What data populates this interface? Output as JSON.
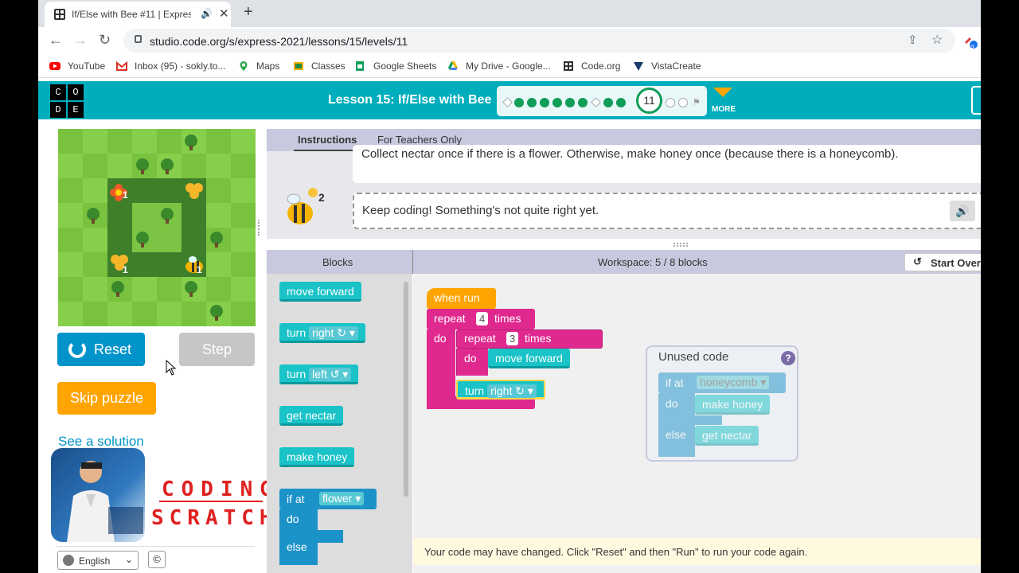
{
  "browser": {
    "tab_title": "If/Else with Bee #11 | Express",
    "url": "studio.code.org/s/express-2021/lessons/15/levels/11",
    "bookmarks": [
      {
        "label": "YouTube",
        "icon": "youtube-icon"
      },
      {
        "label": "Inbox (95) - sokly.to...",
        "icon": "gmail-icon"
      },
      {
        "label": "Maps",
        "icon": "maps-icon"
      },
      {
        "label": "Classes",
        "icon": "classes-icon"
      },
      {
        "label": "Google Sheets",
        "icon": "sheets-icon"
      },
      {
        "label": "My Drive - Google...",
        "icon": "drive-icon"
      },
      {
        "label": "Code.org",
        "icon": "codeorg-icon"
      },
      {
        "label": "VistaCreate",
        "icon": "vistacreate-icon"
      }
    ],
    "extension_badge": "2"
  },
  "header": {
    "logo_letters": [
      "C",
      "O",
      "D",
      "E"
    ],
    "lesson_title": "Lesson 15: If/Else with Bee",
    "current_level": "11",
    "more_label": "MORE",
    "accent": "#00adbc"
  },
  "game": {
    "flower_count_1": "1",
    "flower_count_2": "1",
    "honey_label": "1",
    "reset_label": "Reset",
    "step_label": "Step",
    "skip_label": "Skip puzzle",
    "see_solution": "See a solution",
    "coding_text": "CODING",
    "scratch_text": "SCRATCH",
    "language": "English",
    "copyright": "©"
  },
  "instructions": {
    "tabs": [
      "Instructions",
      "For Teachers Only"
    ],
    "text": "Collect nectar once if there is a flower. Otherwise, make honey once (because there is a honeycomb).",
    "feedback": "Keep coding! Something's not quite right yet.",
    "hint_count": "2"
  },
  "blockly": {
    "blocks_header": "Blocks",
    "workspace_header": "Workspace: 5 / 8 blocks",
    "start_over": "Start Over",
    "toolbox": {
      "move_forward": "move forward",
      "turn": "turn",
      "right": "right ↻",
      "left": "left ↺",
      "get_nectar": "get nectar",
      "make_honey": "make honey",
      "if_at": "if at",
      "flower": "flower",
      "do": "do",
      "else": "else"
    },
    "program": {
      "when_run": "when run",
      "repeat": "repeat",
      "outer_times": "4",
      "times": "times",
      "do": "do",
      "inner_times": "3",
      "move_forward": "move forward",
      "turn": "turn",
      "right": "right ↻"
    },
    "unused": {
      "title": "Unused code",
      "help": "?",
      "if_at": "if at",
      "honeycomb": "honeycomb",
      "do": "do",
      "make_honey": "make honey",
      "else": "else",
      "get_nectar": "get nectar"
    },
    "notice": "Your code may have changed. Click \"Reset\" and then \"Run\" to run your code again."
  }
}
